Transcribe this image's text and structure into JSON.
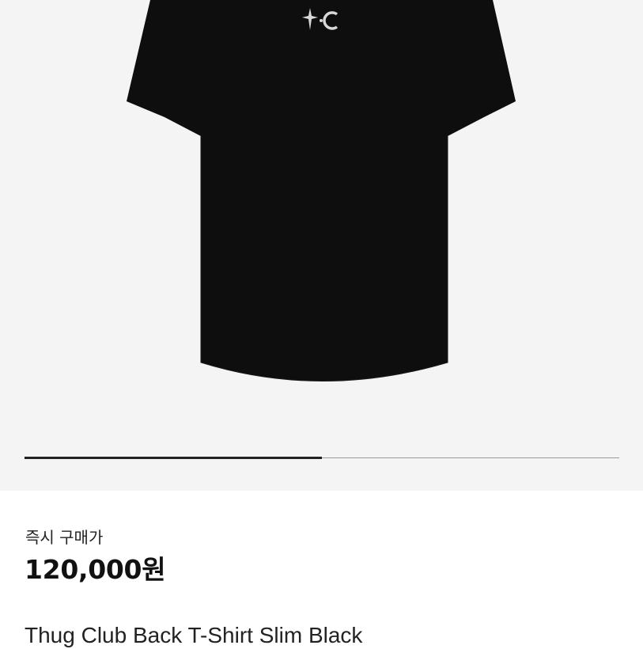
{
  "gallery": {
    "image_alt": "black t-shirt",
    "logo_icon": "tc-star-moon-logo",
    "progress": 0.5
  },
  "product": {
    "price_label": "즉시 구매가",
    "price": "120,000원",
    "name": "Thug Club Back T-Shirt Slim Black"
  },
  "colors": {
    "gallery_bg": "#f4f4f4",
    "shirt": "#0e0e0e",
    "progress_fill": "#222222",
    "progress_track": "#9a9a9a"
  }
}
